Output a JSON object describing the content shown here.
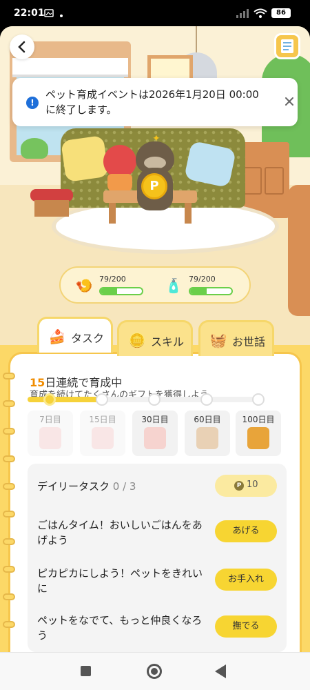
{
  "status_bar": {
    "time": "22:01",
    "battery": "86"
  },
  "toast": {
    "message": "ペット育成イベントは2026年1月20日 00:00に終了します。"
  },
  "gauges": [
    {
      "icon": "food-icon",
      "text": "79/200",
      "value": 79,
      "max": 200
    },
    {
      "icon": "spray-bottle-icon",
      "text": "79/200",
      "value": 79,
      "max": 200
    }
  ],
  "tabs": [
    {
      "label": "タスク",
      "icon": "cake-icon",
      "active": true
    },
    {
      "label": "スキル",
      "icon": "coins-icon",
      "active": false
    },
    {
      "label": "お世話",
      "icon": "basket-icon",
      "active": false
    }
  ],
  "streak": {
    "days": "15",
    "suffix": "日連続で育成中",
    "subtitle": "育成を続けてたくさんのギフトを獲得しよう",
    "progress": 0.25
  },
  "rewards": [
    {
      "label": "7日目",
      "locked": true,
      "color": "#f2c9c9"
    },
    {
      "label": "15日目",
      "locked": true,
      "color": "#f2c9c9"
    },
    {
      "label": "30日目",
      "locked": false,
      "color": "#f6d3cf"
    },
    {
      "label": "60日目",
      "locked": false,
      "color": "#e9d1b5"
    },
    {
      "label": "100日目",
      "locked": false,
      "color": "#e8a43a"
    }
  ],
  "daily": {
    "title": "デイリータスク",
    "count": "0 / 3",
    "points": "10",
    "coin_symbol": "P"
  },
  "tasks": [
    {
      "text": "ごはんタイム！おいしいごはんをあげよう",
      "button": "あげる"
    },
    {
      "text": "ピカピカにしよう！ペットをきれいに",
      "button": "お手入れ"
    },
    {
      "text": "ペットをなでて、もっと仲良くなろう",
      "button": "撫でる"
    }
  ],
  "pet": {
    "coin_symbol": "P"
  },
  "colors": {
    "accent_yellow": "#f7d532",
    "panel_yellow": "#fcd867",
    "streak_orange": "#f08c00",
    "gauge_green": "#6bcf4a",
    "info_blue": "#1e6fd9"
  }
}
